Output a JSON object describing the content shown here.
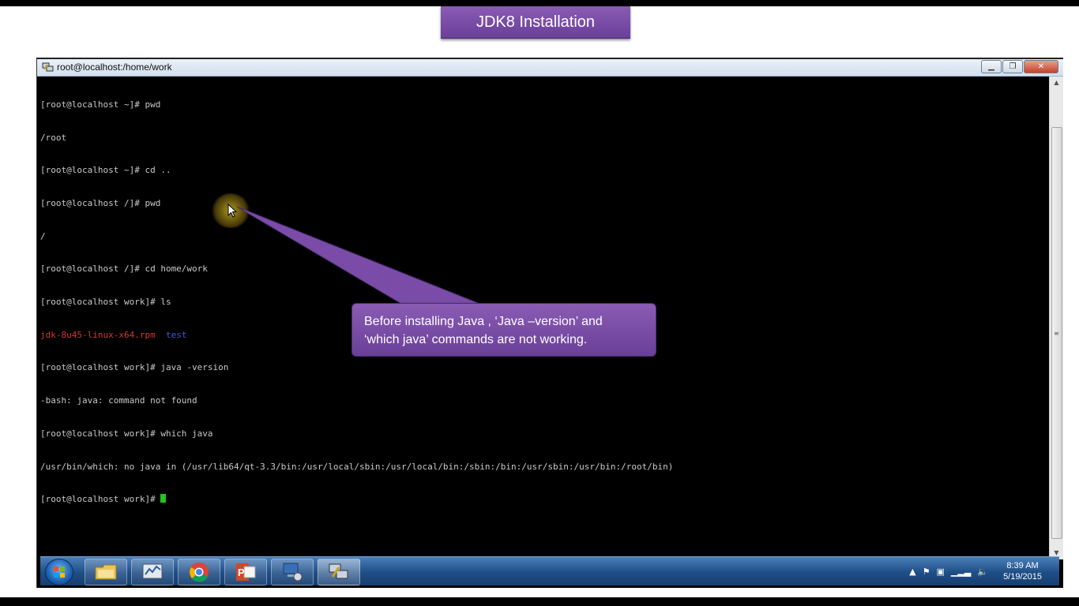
{
  "slide": {
    "title": "JDK8 Installation",
    "callout_line1": "Before installing Java , ‘Java –version’ and",
    "callout_line2": "‘which java’ commands are not working."
  },
  "window": {
    "title": "root@localhost:/home/work",
    "icon": "putty-icon",
    "controls": [
      "minimize",
      "maximize",
      "close"
    ]
  },
  "terminal": {
    "lines": [
      {
        "text": "[root@localhost ~]# pwd"
      },
      {
        "text": "/root"
      },
      {
        "text": "[root@localhost ~]# cd .."
      },
      {
        "text": "[root@localhost /]# pwd"
      },
      {
        "text": "/"
      },
      {
        "text": "[root@localhost /]# cd home/work"
      },
      {
        "text": "[root@localhost work]# ls"
      },
      {
        "file_rpm": "jdk-8u45-linux-x64.rpm",
        "file_dir": "test"
      },
      {
        "text": "[root@localhost work]# java -version"
      },
      {
        "text": "-bash: java: command not found"
      },
      {
        "text": "[root@localhost work]# which java"
      },
      {
        "text": "/usr/bin/which: no java in (/usr/lib64/qt-3.3/bin:/usr/local/sbin:/usr/local/bin:/sbin:/bin:/usr/sbin:/usr/bin:/root/bin)"
      },
      {
        "text": "[root@localhost work]# "
      }
    ],
    "colors": {
      "rpm": "#d23a2a",
      "dir": "#3b5bd6",
      "cursor": "#1ec81e"
    }
  },
  "taskbar": {
    "buttons": [
      "start-orb",
      "explorer-icon",
      "task-manager-icon",
      "chrome-icon",
      "powerpoint-icon",
      "network-computer-icon",
      "putty-icon"
    ],
    "tray_icons": [
      "show-hidden-icons",
      "action-center-flag-icon",
      "power-icon",
      "signal-icon",
      "volume-icon"
    ],
    "time": "8:39 AM",
    "date": "5/19/2015"
  },
  "colors": {
    "accent_purple": "#7a4ca8",
    "taskbar_blue": "#1f4d86"
  }
}
